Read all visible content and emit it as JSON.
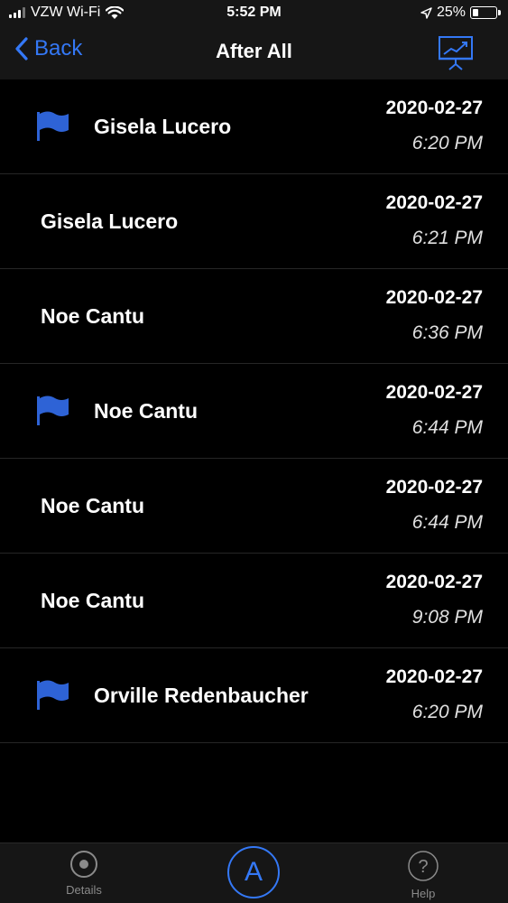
{
  "status_bar": {
    "carrier": "VZW Wi-Fi",
    "time": "5:52 PM",
    "battery_percent": "25%",
    "battery_level": 0.25
  },
  "nav": {
    "back_label": "Back",
    "title": "After All",
    "chart_icon": "presentation-chart-icon"
  },
  "colors": {
    "accent": "#3478f6",
    "flag": "#2e63d6"
  },
  "rows": [
    {
      "name": "Gisela Lucero",
      "date": "2020-02-27",
      "time": "6:20 PM",
      "flagged": true
    },
    {
      "name": "Gisela Lucero",
      "date": "2020-02-27",
      "time": "6:21 PM",
      "flagged": false
    },
    {
      "name": "Noe Cantu",
      "date": "2020-02-27",
      "time": "6:36 PM",
      "flagged": false
    },
    {
      "name": "Noe Cantu",
      "date": "2020-02-27",
      "time": "6:44 PM",
      "flagged": true
    },
    {
      "name": "Noe Cantu",
      "date": "2020-02-27",
      "time": "6:44 PM",
      "flagged": false
    },
    {
      "name": "Noe Cantu",
      "date": "2020-02-27",
      "time": "9:08 PM",
      "flagged": false
    },
    {
      "name": "Orville Redenbaucher",
      "date": "2020-02-27",
      "time": "6:20 PM",
      "flagged": true
    }
  ],
  "tab_bar": {
    "details_label": "Details",
    "center_label": "A",
    "help_label": "Help"
  }
}
